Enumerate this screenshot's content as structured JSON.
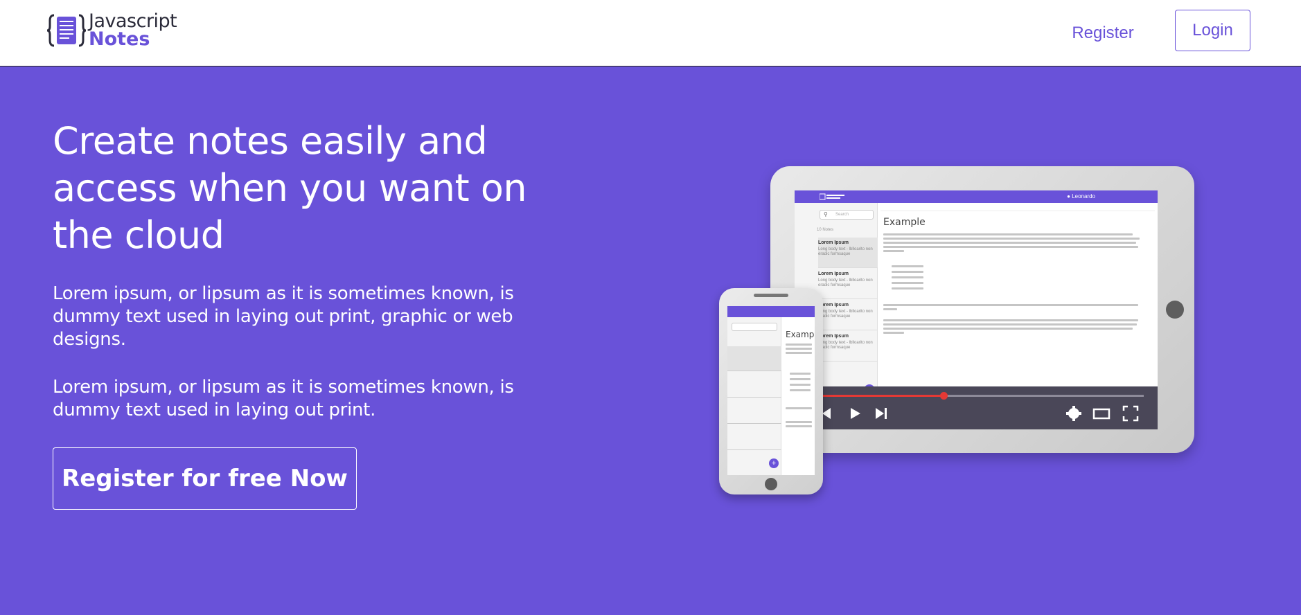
{
  "header": {
    "logo": {
      "line1": "Javascript",
      "line2": "Notes"
    },
    "nav": {
      "register_label": "Register",
      "login_label": "Login"
    }
  },
  "hero": {
    "title": "Create notes easily and access when you want on the cloud",
    "paragraph1": "Lorem ipsum, or lipsum as it is sometimes known, is dummy text used in laying out print, graphic or web designs.",
    "paragraph2": "Lorem ipsum, or lipsum as it is sometimes known, is dummy text used in laying out print.",
    "cta_label": "Register for free Now"
  },
  "illustration": {
    "tablet": {
      "user_name": "Leonardo",
      "search_placeholder": "Search",
      "notes_count": "10 Notes",
      "note_title": "Lorem Ipsum",
      "note_body": "Long body text - lblloarito non eradic formsaque",
      "editor_title": "Example"
    },
    "phone": {
      "editor_title": "Example"
    }
  },
  "colors": {
    "brand": "#6952d9",
    "header_bg": "#ffffff",
    "video_accent": "#e53935"
  },
  "icons": [
    "logo-braces-notebook-icon",
    "search-icon",
    "add-icon",
    "play-icon",
    "skip-next-icon",
    "skip-previous-icon",
    "settings-gear-icon",
    "theater-mode-icon",
    "fullscreen-icon",
    "user-icon"
  ]
}
